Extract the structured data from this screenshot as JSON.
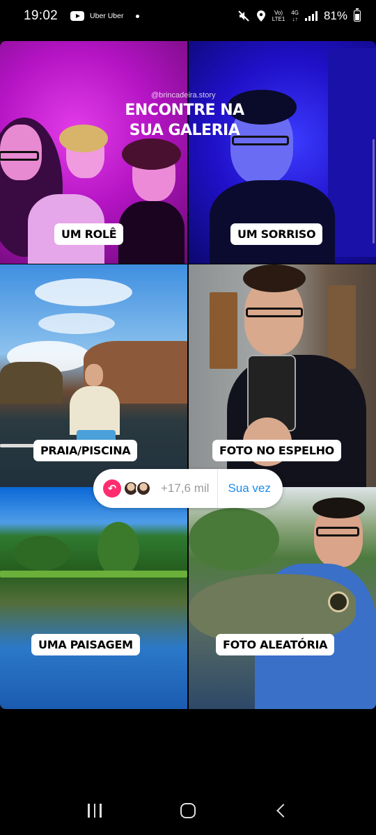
{
  "status_bar": {
    "time": "19:02",
    "notification_text": "Uber Uber",
    "network_top": "Vo)",
    "network_bottom": "LTE1",
    "network_type": "4G",
    "battery": "81%"
  },
  "story": {
    "watermark": "@brincadeira.story",
    "headline": "ENCONTRE NA SUA GALERIA",
    "cells": [
      {
        "label": "UM ROLÊ"
      },
      {
        "label": "UM SORRISO"
      },
      {
        "label": "PRAIA/PISCINA"
      },
      {
        "label": "FOTO NO ESPELHO"
      },
      {
        "label": "UMA PAISAGEM"
      },
      {
        "label": "FOTO ALEATÓRIA"
      }
    ]
  },
  "reply": {
    "count": "+17,6 mil",
    "action_label": "Sua vez",
    "icons": [
      "reply-arrow-icon",
      "avatar",
      "avatar"
    ]
  },
  "navigation": {
    "icons": [
      "recents-icon",
      "home-icon",
      "back-icon"
    ]
  },
  "colors": {
    "reply_icon": "#ff2d6f",
    "action_text": "#1c8bf0"
  }
}
